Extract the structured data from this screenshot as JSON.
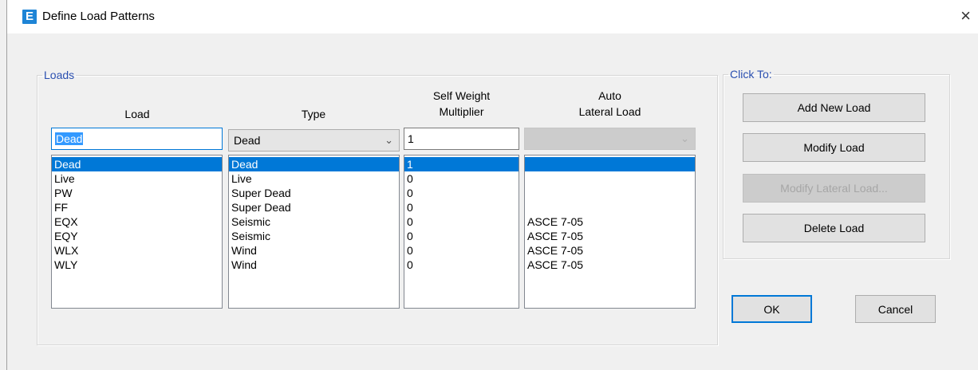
{
  "window": {
    "title": "Define Load Patterns",
    "icon_letter": "E",
    "close_glyph": "×"
  },
  "loads_group": {
    "legend": "Loads",
    "headers": {
      "load": "Load",
      "type": "Type",
      "self_weight_line1": "Self Weight",
      "self_weight_line2": "Multiplier",
      "auto_line1": "Auto",
      "auto_line2": "Lateral Load"
    },
    "inputs": {
      "load_name": "Dead",
      "type_selected": "Dead",
      "self_weight": "1",
      "auto_lateral": ""
    },
    "rows": [
      {
        "load": "Dead",
        "type": "Dead",
        "multiplier": "1",
        "auto": ""
      },
      {
        "load": "Live",
        "type": "Live",
        "multiplier": "0",
        "auto": ""
      },
      {
        "load": "PW",
        "type": "Super Dead",
        "multiplier": "0",
        "auto": ""
      },
      {
        "load": "FF",
        "type": "Super Dead",
        "multiplier": "0",
        "auto": ""
      },
      {
        "load": "EQX",
        "type": "Seismic",
        "multiplier": "0",
        "auto": "ASCE 7-05"
      },
      {
        "load": "EQY",
        "type": "Seismic",
        "multiplier": "0",
        "auto": "ASCE 7-05"
      },
      {
        "load": "WLX",
        "type": "Wind",
        "multiplier": "0",
        "auto": "ASCE 7-05"
      },
      {
        "load": "WLY",
        "type": "Wind",
        "multiplier": "0",
        "auto": "ASCE 7-05"
      }
    ]
  },
  "click_group": {
    "legend": "Click To:",
    "add_new_load": "Add New Load",
    "modify_load": "Modify Load",
    "modify_lateral_load": "Modify Lateral Load...",
    "delete_load": "Delete Load"
  },
  "footer": {
    "ok": "OK",
    "cancel": "Cancel"
  },
  "colors": {
    "selection": "#0078d7",
    "legend_text": "#2a4fb0",
    "app_icon": "#1d84d6"
  }
}
